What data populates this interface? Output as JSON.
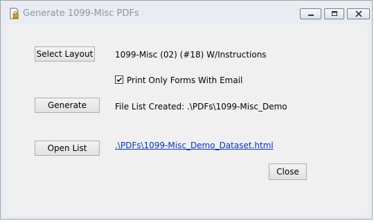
{
  "window": {
    "title": "Generate 1099-Misc PDFs",
    "icons": {
      "app": "document-lock-icon",
      "minimize": "minimize-icon",
      "maximize": "maximize-icon",
      "close": "close-icon"
    }
  },
  "form": {
    "select_layout_label": "Select Layout",
    "layout_value": "1099-Misc (02) (#18) W/Instructions",
    "email_checkbox_label": "Print Only Forms With Email",
    "email_checkbox_checked": true,
    "generate_label": "Generate",
    "file_list_status": "File List Created: .\\PDFs\\1099-Misc_Demo",
    "open_list_label": "Open List",
    "dataset_link": ".\\PDFs\\1099-Misc_Demo_Dataset.html",
    "close_label": "Close"
  }
}
